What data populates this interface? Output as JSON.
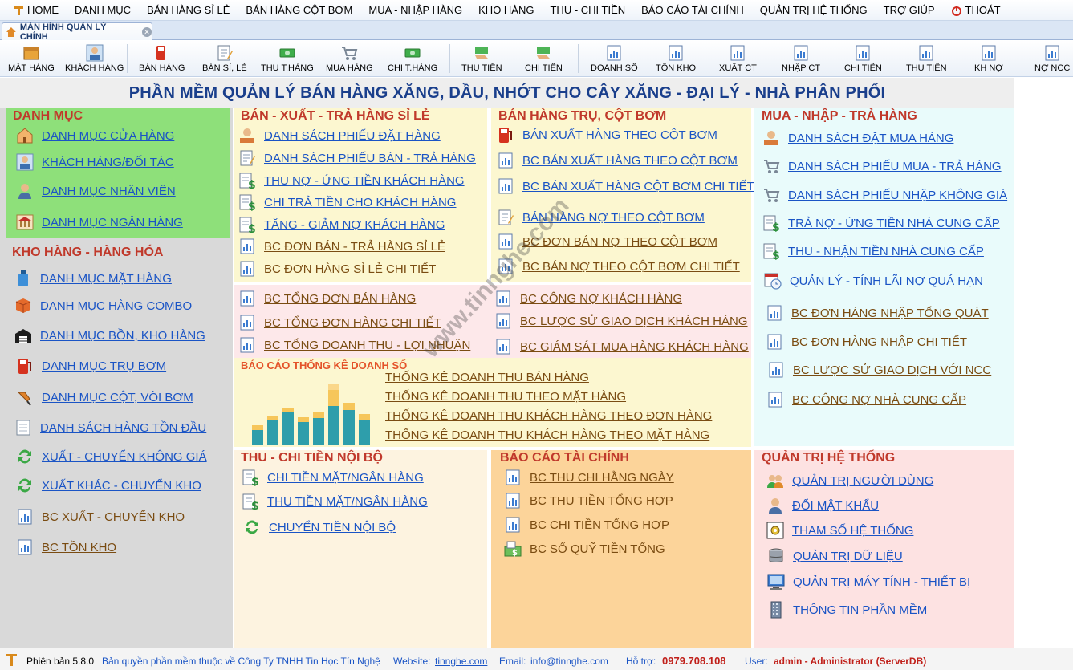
{
  "menu": {
    "items": [
      "HOME",
      "DANH MỤC",
      "BÁN HÀNG SỈ LẺ",
      "BÁN HÀNG CỘT BƠM",
      "MUA - NHẬP HÀNG",
      "KHO HÀNG",
      "THU - CHI TIỀN",
      "BÁO CÁO TÀI CHÍNH",
      "QUẢN TRỊ HỆ THỐNG",
      "TRỢ GIÚP",
      "THOÁT"
    ]
  },
  "tab": {
    "label": "MÀN HÌNH QUẢN LÝ CHÍNH"
  },
  "toolbar": {
    "buttons": [
      "MẶT HÀNG",
      "KHÁCH HÀNG",
      "BÁN HÀNG",
      "BÁN SỈ, LẺ",
      "THU T.HÀNG",
      "MUA HÀNG",
      "CHI T.HÀNG",
      "THU TIỀN",
      "CHI TIỀN",
      "DOANH SỐ",
      "TỒN KHO",
      "XUẤT CT",
      "NHẬP CT",
      "CHI TIỀN",
      "THU TIỀN",
      "KH NỢ",
      "NỢ NCC"
    ]
  },
  "banner": "PHẦN MỀM QUẢN LÝ BÁN HÀNG XĂNG, DẦU, NHỚT CHO CÂY XĂNG - ĐẠI LÝ - NHÀ PHÂN PHỐI",
  "danh_muc": {
    "title": "DANH MỤC",
    "links": [
      "DANH MỤC CỬA HÀNG",
      "KHÁCH HÀNG/ĐỐI TÁC",
      "DANH MỤC NHÂN VIÊN",
      "DANH MỤC NGÂN HÀNG"
    ]
  },
  "kho_hang": {
    "title": "KHO HÀNG - HÀNG HÓA",
    "links": [
      "DANH MỤC MẶT HÀNG",
      "DANH MỤC HÀNG COMBO",
      "DANH MỤC BỒN, KHO HÀNG",
      "DANH MỤC TRỤ BƠM",
      "DANH MỤC CỘT, VÒI BƠM",
      "DANH SÁCH HÀNG TỒN ĐẦU",
      "XUẤT - CHUYỂN KHÔNG GIÁ",
      "XUẤT KHÁC - CHUYỂN KHO",
      "BC XUẤT - CHUYỂN KHO",
      "BC TỒN KHO"
    ]
  },
  "ban_si_le": {
    "title": "BÁN - XUẤT - TRẢ HÀNG SỈ LẺ",
    "links": [
      "DANH SÁCH PHIẾU ĐẶT HÀNG",
      "DANH SÁCH PHIẾU BÁN - TRẢ HÀNG",
      "THU NỢ - ỨNG TIỀN KHÁCH HÀNG",
      "CHI TRẢ TIỀN CHO KHÁCH HÀNG",
      "TĂNG - GIẢM NỢ KHÁCH HÀNG",
      "BC ĐƠN BÁN - TRẢ HÀNG SỈ LẺ",
      "BC ĐƠN HÀNG SỈ LẺ CHI TIẾT"
    ]
  },
  "cot_bom": {
    "title": "BÁN HÀNG TRỤ, CỘT BƠM",
    "links": [
      "BÁN XUẤT HÀNG THEO CỘT BƠM",
      "BC  BÁN XUẤT HÀNG THEO CỘT BƠM",
      "BC BÁN XUẤT HÀNG CỘT BƠM CHI TIẾT",
      "BÁN HÀNG NỢ THEO CỘT BƠM",
      "BC ĐƠN BÁN NỢ THEO CỘT BƠM",
      "BC BÁN NỢ THEO CỘT BƠM CHI TIẾT"
    ]
  },
  "tong_hop": {
    "links_left": [
      "BC TỔNG ĐƠN BÁN HÀNG",
      "BC TỔNG ĐƠN HÀNG CHI TIẾT",
      "BC TỔNG DOANH THU - LỢI NHUẬN"
    ],
    "links_right": [
      "BC CÔNG NỢ KHÁCH HÀNG",
      "BC LƯỢC SỬ GIAO DỊCH KHÁCH HÀNG",
      "BC GIÁM SÁT MUA HÀNG KHÁCH HÀNG"
    ]
  },
  "thong_ke": {
    "title": "BÁO CÁO THỐNG KÊ DOANH SỐ",
    "links": [
      "THỐNG KÊ DOANH THU BÁN HÀNG",
      "THỐNG KÊ DOANH THU THEO MẶT HÀNG",
      "THỐNG KÊ DOANH THU KHÁCH HÀNG THEO ĐƠN HÀNG",
      "THỐNG KÊ DOANH THU KHÁCH HÀNG THEO MẶT HÀNG"
    ]
  },
  "mua_nhap": {
    "title": "MUA - NHẬP - TRẢ HÀNG",
    "links": [
      "DANH SÁCH ĐẶT MUA HÀNG",
      "DANH SÁCH PHIẾU MUA - TRẢ HÀNG",
      "DANH SÁCH PHIẾU NHẬP KHÔNG GIÁ",
      "TRẢ NỢ - ỨNG TIỀN NHÀ CUNG CẤP",
      "THU - NHẬN TIỀN NHÀ CUNG CẤP",
      "QUẢN LÝ - TÍNH LÃI  NỢ QUÁ HẠN",
      "BC ĐƠN HÀNG NHẬP TỔNG QUÁT",
      "BC ĐƠN HÀNG NHẬP CHI TIẾT",
      "BC LƯỢC SỬ GIAO DỊCH VỚI NCC",
      "BC CÔNG NỢ NHÀ CUNG CẤP"
    ]
  },
  "thu_chi": {
    "title": "THU - CHI TIỀN NỘI BỘ",
    "links": [
      "CHI TIỀN MẶT/NGÂN HÀNG",
      "THU TIỀN MẶT/NGÂN HÀNG",
      "CHUYỂN TIỀN NỘI BỘ"
    ]
  },
  "tai_chinh": {
    "title": "BÁO CÁO TÀI CHÍNH",
    "links": [
      "BC THU CHI HẰNG NGÀY",
      "BC THU TIỀN TỔNG HỢP",
      "BC CHI TIỀN TỔNG HỢP",
      "BC SỔ QUỸ TIỀN TỔNG"
    ]
  },
  "quan_tri": {
    "title": "QUẢN TRỊ HỆ THỐNG",
    "links": [
      "QUẢN TRỊ NGƯỜI DÙNG",
      "ĐỔI MẬT KHẨU",
      "THAM SỐ HỆ THỐNG",
      "QUẢN TRỊ DỮ LIỆU",
      "QUẢN TRỊ MÁY TÍNH - THIẾT BỊ",
      "THÔNG TIN PHẦN MỀM"
    ]
  },
  "status": {
    "version": "Phiên bản 5.8.0",
    "copyright": "Bản quyền phần mềm thuộc về Công Ty TNHH Tin Học Tín Nghệ",
    "website_label": "Website:",
    "website": "tinnghe.com",
    "email_label": "Email:",
    "email": "info@tinnghe.com",
    "hotline_label": "Hỗ trợ:",
    "hotline": "0979.708.108",
    "user_label": "User:",
    "user": "admin - Administrator (ServerDB)"
  },
  "watermark": "www.tinnghe.com"
}
